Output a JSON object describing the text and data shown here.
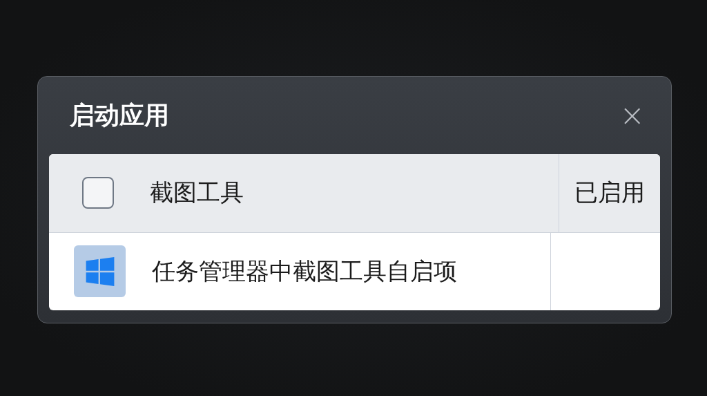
{
  "dialog": {
    "title": "启动应用",
    "close": "×"
  },
  "table": {
    "header": {
      "checked": false,
      "name": "截图工具",
      "status": "已启用"
    },
    "rows": [
      {
        "kind": "windows",
        "name": "任务管理器中截图工具自启项"
      }
    ]
  }
}
